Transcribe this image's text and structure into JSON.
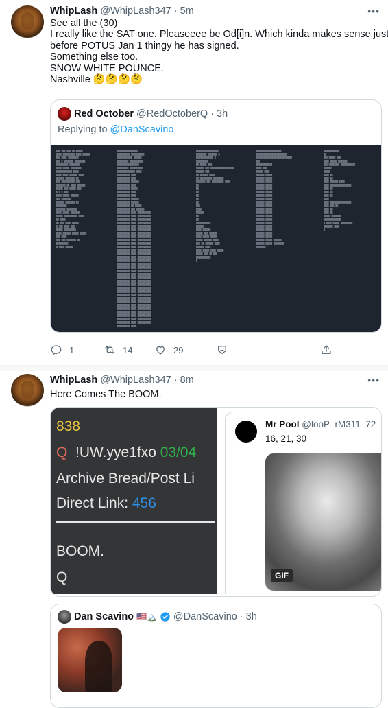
{
  "tweet1": {
    "name": "WhipLash",
    "handle": "@WhipLash347",
    "dot": "·",
    "time": "5m",
    "more": "•••",
    "lines": [
      "See all the (30)",
      "I really like the SAT one. Pleaseeee be Od[i]n. Which kinda makes sense just",
      "before POTUS Jan 1 thingy he has signed.",
      "Something else too.",
      "SNOW WHITE POUNCE.",
      "Nashville 🤔🤔🤔🤔"
    ],
    "quote": {
      "name": "Red October",
      "handle": "@RedOctoberQ",
      "dot": "·",
      "time": "3h",
      "replying_prefix": "Replying to ",
      "replying_handle": "@DanScavino"
    },
    "actions": {
      "replies": "1",
      "retweets": "14",
      "likes": "29"
    }
  },
  "tweet2": {
    "name": "WhipLash",
    "handle": "@WhipLash347",
    "dot": "·",
    "time": "8m",
    "more": "•••",
    "text": "Here Comes The BOOM.",
    "card": {
      "post_number": "838",
      "q": "Q",
      "trip": "!UW.yye1fxo",
      "date": "03/04",
      "archive": "Archive Bread/Post Li",
      "direct_label": "Direct Link:",
      "direct_value": "456",
      "boom": "BOOM.",
      "sign": "Q",
      "colors": {
        "bg": "#343537",
        "yellow": "#e6c341",
        "red": "#e06a5c",
        "green": "#2fb24c",
        "blue": "#2f8fe6"
      }
    },
    "inner": {
      "name": "Mr Pool",
      "handle": "@looP_rM311_72",
      "text": "16, 21, 30",
      "gif_label": "GIF"
    },
    "quote2": {
      "name": "Dan Scavino",
      "emojis": "🇺🇸🏔️",
      "handle": "@DanScavino",
      "dot": "·",
      "time": "3h"
    }
  }
}
